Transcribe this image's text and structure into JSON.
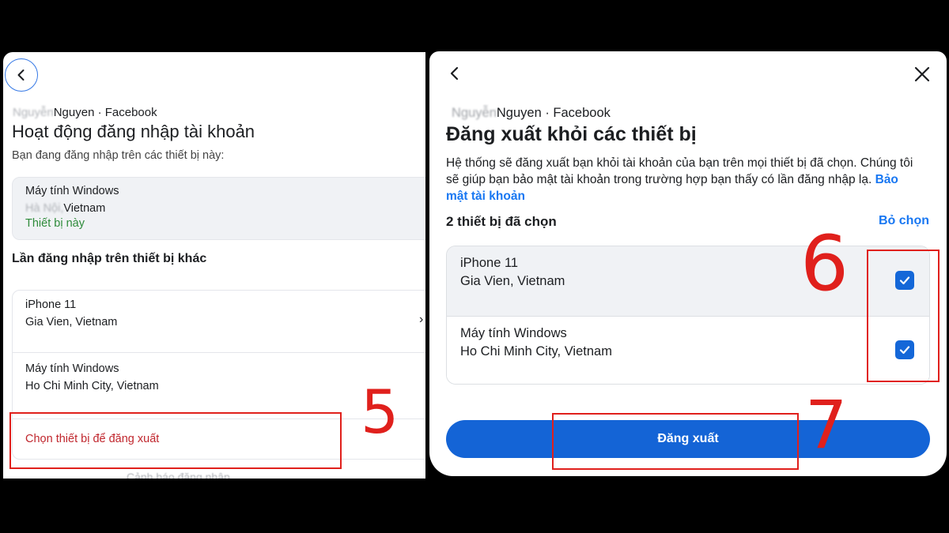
{
  "left": {
    "account_name_blurred": "Nguyễn",
    "account_suffix": "Nguyen · Facebook",
    "title": "Hoạt động đăng nhập tài khoản",
    "subtitle": "Bạn đang đăng nhập trên các thiết bị này:",
    "current_device": {
      "name": "Máy tính Windows",
      "location_blurred": "Hà Nội,",
      "location": "Vietnam",
      "status": "Thiết bị này"
    },
    "section_title": "Lần đăng nhập trên thiết bị khác",
    "other_devices": [
      {
        "name": "iPhone 11",
        "location": "Gia Vien, Vietnam"
      },
      {
        "name": "Máy tính Windows",
        "location": "Ho Chi Minh City, Vietnam"
      }
    ],
    "select_logout_label": "Chọn thiết bị để đăng xuất",
    "warning_label": "Cảnh báo đăng nhập"
  },
  "right": {
    "account_name_blurred": "Nguyễn",
    "account_suffix": "Nguyen · Facebook",
    "title": "Đăng xuất khỏi các thiết bị",
    "description": "Hệ thống sẽ đăng xuất bạn khỏi tài khoản của bạn trên mọi thiết bị đã chọn. Chúng tôi sẽ giúp bạn bảo mật tài khoản trong trường hợp bạn thấy có lần đăng nhập lạ.",
    "security_link": "Bảo mật tài khoản",
    "selected_count_label": "2 thiết bị đã chọn",
    "deselect_label": "Bỏ chọn",
    "devices": [
      {
        "name": "iPhone 11",
        "location": "Gia Vien, Vietnam",
        "checked": true
      },
      {
        "name": "Máy tính Windows",
        "location": "Ho Chi Minh City, Vietnam",
        "checked": true
      }
    ],
    "logout_button": "Đăng xuất"
  },
  "annotations": {
    "step5": "5",
    "step6": "6",
    "step7": "7",
    "color": "#e0201c"
  }
}
